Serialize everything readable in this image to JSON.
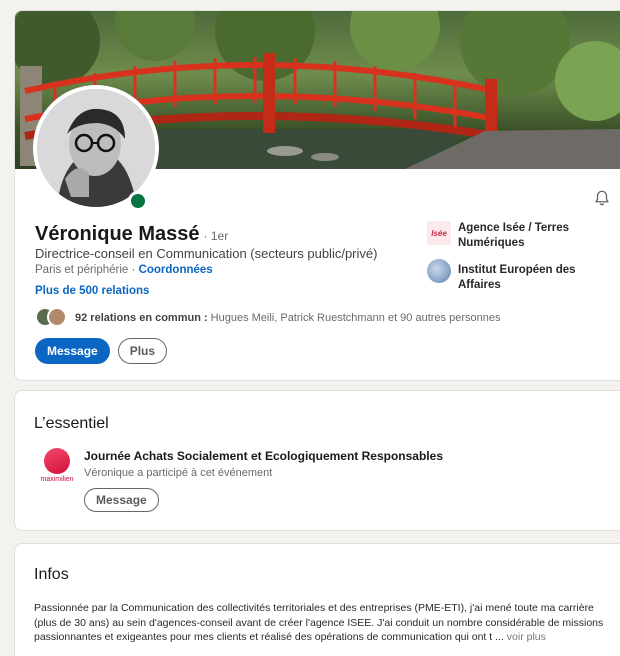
{
  "profile": {
    "name": "Véronique Massé",
    "degree": "· 1er",
    "headline": "Directrice-conseil en Communication (secteurs public/privé)",
    "location": "Paris et périphérie ·",
    "contact_link": "Coordonnées",
    "relations": "Plus de 500 relations",
    "common": {
      "count": "92 relations en commun :",
      "names": "Hugues Meili, Patrick Ruestchmann et 90 autres personnes"
    },
    "buttons": {
      "message": "Message",
      "more": "Plus"
    },
    "experiences": [
      {
        "name": "Agence Isée / Terres Numériques",
        "logo_text": "Isée"
      },
      {
        "name": "Institut Européen des Affaires"
      }
    ]
  },
  "essentiel": {
    "title": "L’essentiel",
    "event_title": "Journée Achats Socialement et Ecologiquement Responsables",
    "event_sub": "Véronique a participé à cet événement",
    "event_logo_text": "maximilien",
    "message_button": "Message"
  },
  "infos": {
    "title": "Infos",
    "text": "Passionnée par la Communication des collectivités territoriales et des entreprises (PME-ETI), j'ai mené toute ma carrière (plus de 30 ans) au sein d'agences-conseil avant de créer l'agence ISEE. J'ai conduit un nombre considérable de missions passionnantes et exigeantes pour mes clients et réalisé des opérations de communication qui ont t ...",
    "more": "voir plus"
  },
  "colors": {
    "accent": "#0a66c2",
    "online": "#057642",
    "bridge": "#d8321e"
  },
  "icons": {
    "bell": "bell-icon"
  }
}
